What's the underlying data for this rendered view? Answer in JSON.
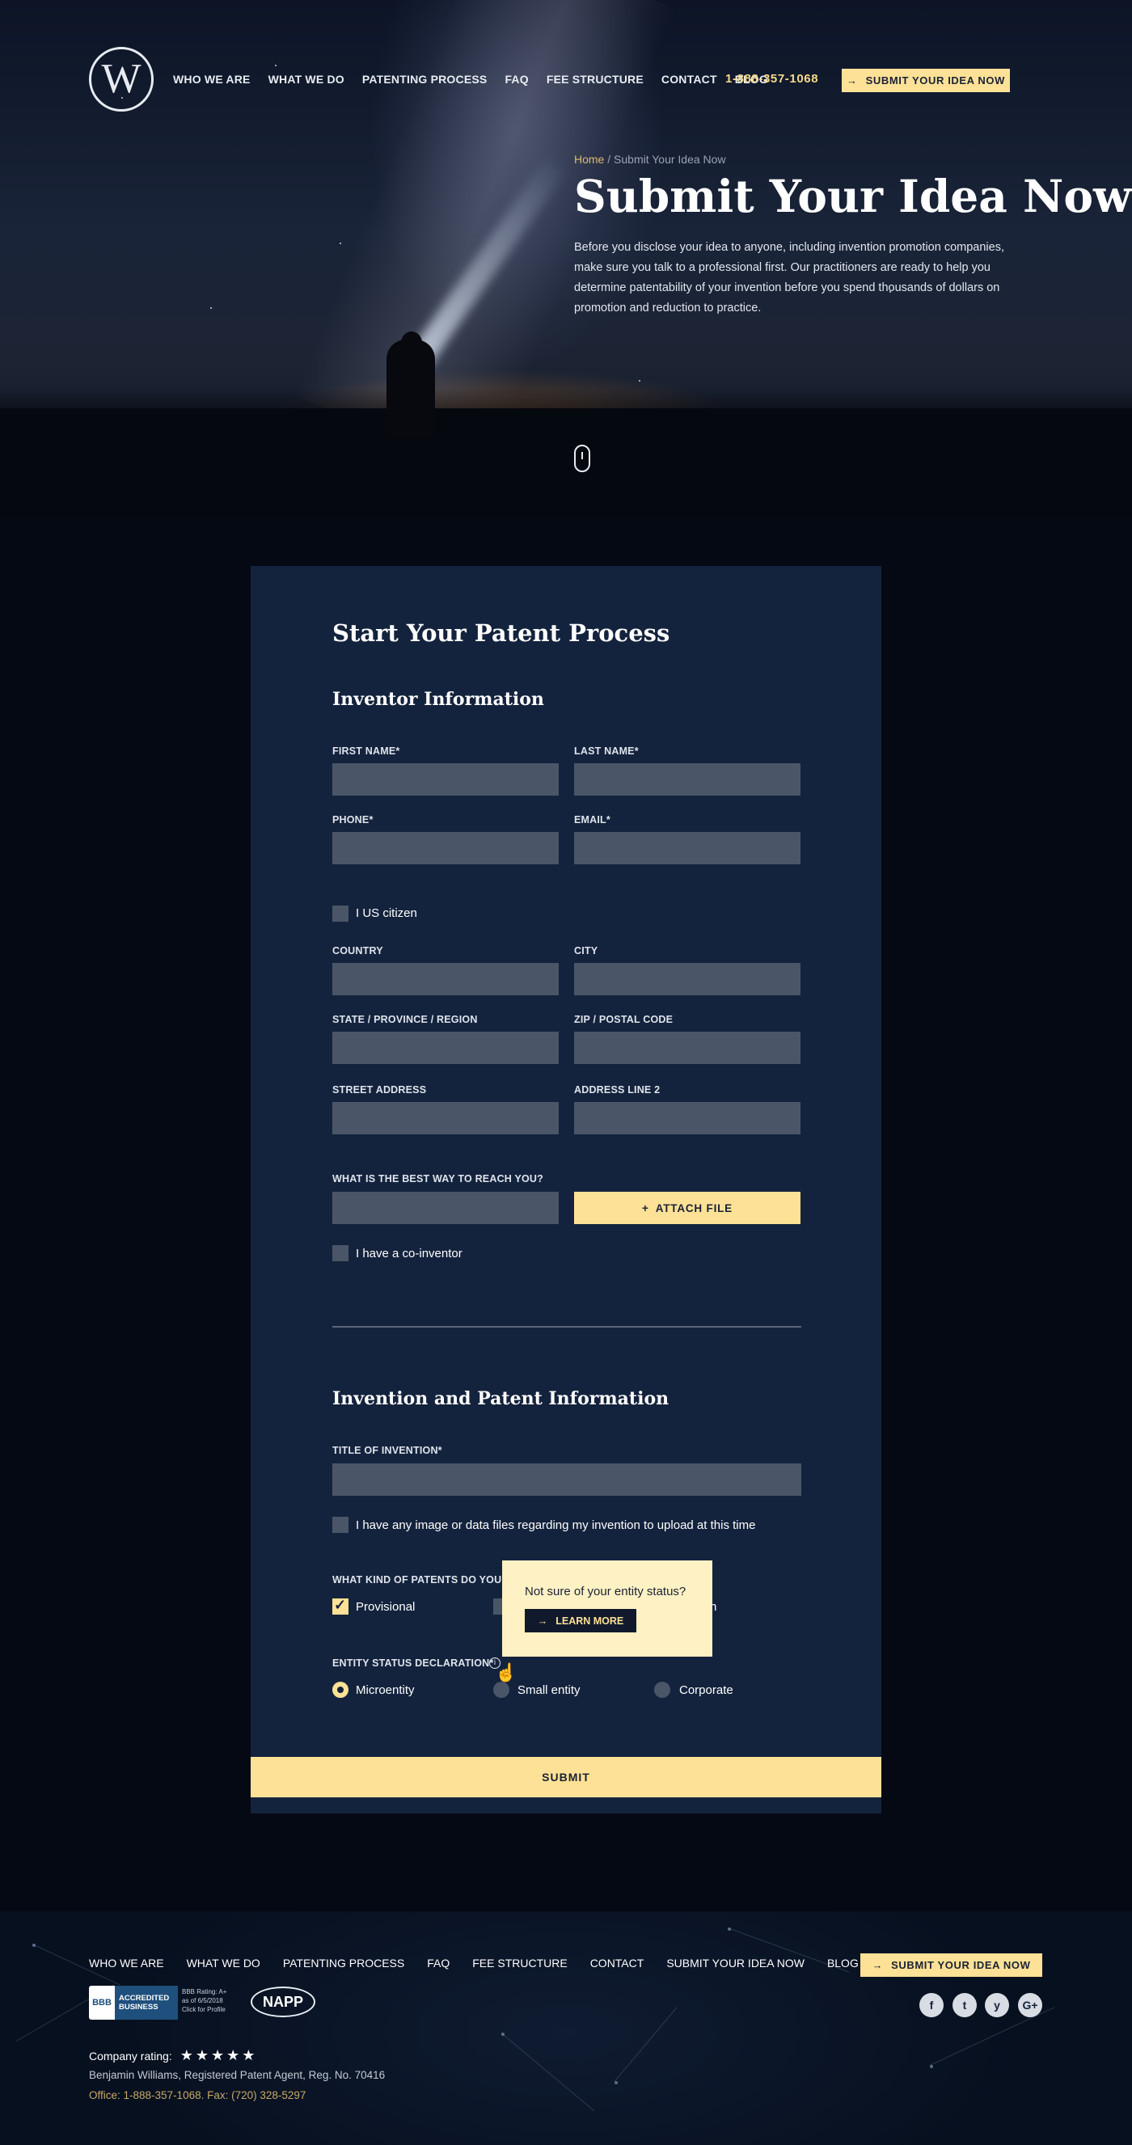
{
  "header": {
    "logo_letter": "W",
    "nav": [
      "WHO WE ARE",
      "WHAT WE DO",
      "PATENTING PROCESS",
      "FAQ",
      "FEE STRUCTURE",
      "CONTACT",
      "BLOG"
    ],
    "phone": "1-888-357-1068",
    "cta": "SUBMIT YOUR IDEA NOW"
  },
  "hero": {
    "breadcrumb_home": "Home",
    "breadcrumb_sep": " / ",
    "breadcrumb_current": "Submit Your Idea Now",
    "title": "Submit Your Idea Now",
    "text": "Before you disclose your idea to anyone, including invention promotion companies, make sure you talk to a professional first. Our practitioners are ready to help you determine patentability of your invention before you spend thousands of dollars on promotion and reduction to practice."
  },
  "form": {
    "title": "Start Your Patent Process",
    "inventor_title": "Inventor Information",
    "first_name": "FIRST NAME*",
    "last_name": "LAST NAME*",
    "phone": "PHONE*",
    "email": "EMAIL*",
    "us_citizen": "I US citizen",
    "country": "COUNTRY",
    "city": "CITY",
    "state": "STATE / PROVINCE / REGION",
    "zip": "ZIP / POSTAL CODE",
    "street": "STREET ADDRESS",
    "address2": "ADDRESS LINE 2",
    "reach": "WHAT IS THE BEST WAY TO REACH YOU?",
    "attach": "ATTACH FILE",
    "co_inventor": "I have a co-inventor",
    "invention_title": "Invention and Patent Information",
    "title_of_invention": "TITLE OF INVENTION*",
    "files": "I have any image or data files regarding my invention to upload at this time",
    "patent_kind": "WHAT KIND OF PATENTS DO YOU W",
    "provisional": "Provisional",
    "hidden_option_tail": "n",
    "entity_label": "ENTITY STATUS DECLARATION*",
    "entity_options": [
      "Microentity",
      "Small entity",
      "Corporate"
    ],
    "tooltip_text": "Not sure of your entity status?",
    "tooltip_button": "LEARN MORE",
    "submit": "SUBMIT"
  },
  "footer": {
    "nav": [
      "WHO WE ARE",
      "WHAT WE DO",
      "PATENTING PROCESS",
      "FAQ",
      "FEE STRUCTURE",
      "CONTACT",
      "SUBMIT YOUR IDEA NOW",
      "BLOG"
    ],
    "cta": "SUBMIT YOUR IDEA NOW",
    "bbb_mark": "BBB",
    "bbb_line1": "ACCREDITED",
    "bbb_line2": "BUSINESS",
    "bbb_rating1": "BBB Rating: A+",
    "bbb_rating2": "as of 6/5/2018",
    "bbb_rating3": "Click for Profile",
    "napp": "NAPP",
    "social": [
      "f",
      "t",
      "y",
      "G+"
    ],
    "rating_label": "Company rating:",
    "stars": "★★★★★",
    "rating_value": 5,
    "agent": "Benjamin Williams, Registered Patent Agent, Reg. No. 70416",
    "office": "Office: 1-888-357-1068. Fax: (720) 328-5297"
  },
  "colors": {
    "accent": "#fde196",
    "card": "#14233d",
    "input": "#4a5567",
    "page": "#050914"
  }
}
